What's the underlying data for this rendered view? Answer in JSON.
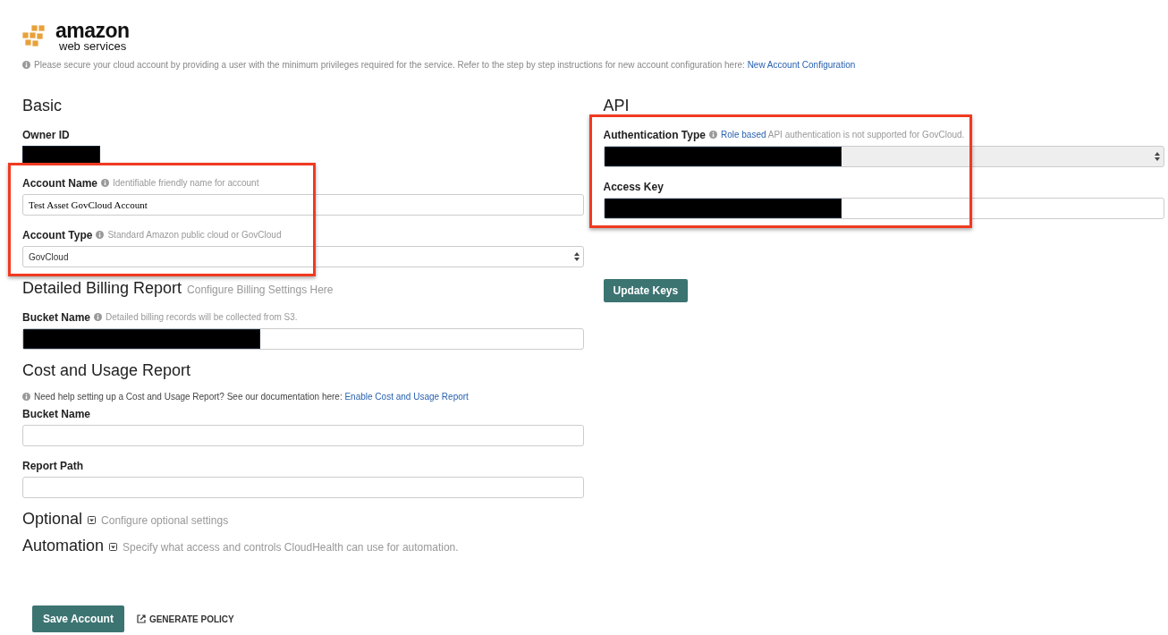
{
  "logo": {
    "wordmark": "amazon",
    "tagline": "web services"
  },
  "notice": {
    "text": "Please secure your cloud account by providing a user with the minimum privileges required for the service. Refer to the step by step instructions for new account configuration here: ",
    "link": "New Account Configuration"
  },
  "left": [
    {
      "title": "Basic",
      "fields": [
        {
          "kind": "static",
          "label": "Owner ID",
          "redacted": true
        },
        {
          "kind": "text",
          "label": "Account Name",
          "hint": "Identifiable friendly name for account",
          "value": "Test Asset GovCloud Account",
          "highlighted": true
        },
        {
          "kind": "select",
          "label": "Account Type",
          "hint": "Standard Amazon public cloud or GovCloud",
          "value": "GovCloud",
          "disabled": false,
          "highlighted": true
        }
      ]
    },
    {
      "title": "Detailed Billing Report",
      "subtitle": "Configure Billing Settings Here",
      "fields": [
        {
          "kind": "text",
          "label": "Bucket Name",
          "hint": "Detailed billing records will be collected from S3.",
          "redacted": true
        }
      ]
    },
    {
      "title": "Cost and Usage Report",
      "notice": {
        "text": "Need help setting up a Cost and Usage Report? See our documentation here: ",
        "link": "Enable Cost and Usage Report"
      },
      "fields": [
        {
          "kind": "text",
          "label": "Bucket Name"
        },
        {
          "kind": "text",
          "label": "Report Path"
        }
      ]
    },
    {
      "title": "Optional",
      "subtitle": "Configure optional settings",
      "expanded": false
    },
    {
      "title": "Automation",
      "subtitle": "Specify what access and controls CloudHealth can use for automation.",
      "expanded": false
    }
  ],
  "right": [
    {
      "title": "API",
      "fields": [
        {
          "kind": "select",
          "label": "Authentication Type",
          "hint_link": "Role based",
          "hint": " API authentication is not supported for GovCloud.",
          "redacted": true,
          "disabled": true,
          "highlighted": true
        },
        {
          "kind": "text",
          "label": "Access Key",
          "redacted": true,
          "highlighted": true
        }
      ],
      "button": "Update Keys"
    }
  ],
  "actions": {
    "primary": "Save Account",
    "secondary": "GENERATE POLICY"
  }
}
